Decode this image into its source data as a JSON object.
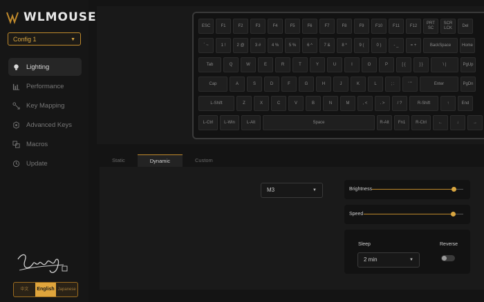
{
  "brand": {
    "name": "WLMOUSE",
    "accent": "#d9a640"
  },
  "config_select": {
    "value": "Config 1"
  },
  "nav": [
    {
      "label": "Lighting",
      "icon": "bulb-icon",
      "active": true
    },
    {
      "label": "Performance",
      "icon": "bars-icon",
      "active": false
    },
    {
      "label": "Key Mapping",
      "icon": "key-mapping-icon",
      "active": false
    },
    {
      "label": "Advanced Keys",
      "icon": "advanced-keys-icon",
      "active": false
    },
    {
      "label": "Macros",
      "icon": "macros-icon",
      "active": false
    },
    {
      "label": "Update",
      "icon": "update-icon",
      "active": false
    }
  ],
  "language": {
    "options": [
      "中文",
      "English",
      "Japanese"
    ],
    "selected": "English"
  },
  "keyboard_rows": [
    [
      "ESC",
      "F1",
      "F2",
      "F3",
      "F4",
      "F5",
      "F6",
      "F7",
      "F8",
      "F9",
      "F10",
      "F11",
      "F12",
      "PRT SC",
      "SCR\nLCK",
      "Del"
    ],
    [
      "` ~",
      "1 !",
      "2 @",
      "3 #",
      "4 %",
      "5 %",
      "6 ^",
      "7 &",
      "8 *",
      "9 (",
      "0 )",
      "- _",
      "= +",
      "BackSpace",
      "Home"
    ],
    [
      "Tab",
      "Q",
      "W",
      "E",
      "R",
      "T",
      "Y",
      "U",
      "I",
      "O",
      "P",
      "[ {",
      "] }",
      "\\ |",
      "PgUp"
    ],
    [
      "Cap",
      "A",
      "S",
      "D",
      "F",
      "G",
      "H",
      "J",
      "K",
      "L",
      "; :",
      "' \"",
      "Enter",
      "PgDn"
    ],
    [
      "L-Shift",
      "Z",
      "X",
      "C",
      "V",
      "B",
      "N",
      "M",
      ", <",
      ". >",
      "/ ?",
      "R-Shift",
      "↑",
      "End"
    ],
    [
      "L-Ctrl",
      "L-Win",
      "L-Alt",
      "Space",
      "R-Alt",
      "Fn1",
      "R-Ctrl",
      "←",
      "↓",
      "→"
    ]
  ],
  "tabs": [
    "Static",
    "Dynamic",
    "Custom"
  ],
  "active_tab": "Dynamic",
  "effect_select": {
    "value": "M3"
  },
  "brightness": {
    "label": "Brightness",
    "level": 0.9
  },
  "speed": {
    "label": "Speed",
    "level": 0.9
  },
  "sleep": {
    "label": "Sleep",
    "value": "2 min"
  },
  "reverse": {
    "label": "Reverse",
    "on": false
  }
}
